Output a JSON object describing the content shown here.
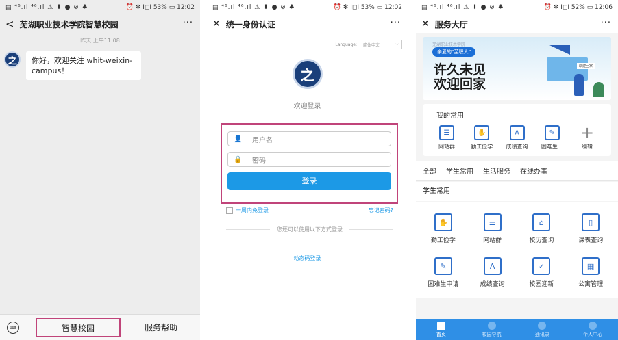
{
  "panel1": {
    "status": {
      "left": "▤ ⁴⁶.ıl ⁴⁶.ıl ⚠ ⬇ ● ⊘ ♣",
      "right": "⏰ ✻ I◻I 53% ▭ 12:02"
    },
    "title": "芜湖职业技术学院智慧校园",
    "more": "···",
    "timestamp": "昨天 上午11:08",
    "avatar": "之",
    "message": "你好，欢迎关注 whit-weixin-campus！",
    "menu": [
      "智慧校园",
      "服务帮助"
    ]
  },
  "panel2": {
    "status": {
      "left": "▤ ⁴⁶.ıl ⁴⁶.ıl ⚠ ⬇ ● ⊘ ♣",
      "right": "⏰ ✻ I◻I 53% ▭ 12:02"
    },
    "title": "统一身份认证",
    "more": "···",
    "language_label": "Language:",
    "language_value": "简体中文",
    "logo": "之",
    "welcome": "欢迎登录",
    "username_placeholder": "用户名",
    "password_placeholder": "密码",
    "login_button": "登录",
    "remember": "一周内免登录",
    "forgot": "忘记密码?",
    "alt_text": "您还可以使用以下方式登录",
    "dynamic_login": "动态码登录"
  },
  "panel3": {
    "status": {
      "left": "▤ ⁴⁶.ıl ⁴⁶.ıl ⚠ ⬇ ● ⊘ ♣",
      "right": "⏰ ✻ I◻I 52% ▭ 12:06"
    },
    "title": "服务大厅",
    "more": "···",
    "banner": {
      "small": "芜湖职业技术学院",
      "pill": "亲爱的“芜职人”",
      "line1": "许久未见",
      "line2": "欢迎回家",
      "sign": "欢迎回家"
    },
    "favorites_title": "我的常用",
    "favorites": [
      "网站群",
      "勤工俭学",
      "成绩查询",
      "困难生...",
      "编辑"
    ],
    "tabs": [
      "全部",
      "学生常用",
      "生活服务",
      "在线办事"
    ],
    "section_title": "学生常用",
    "grid": [
      "勤工俭学",
      "网站群",
      "校历查询",
      "课表查询",
      "困难生申请",
      "成绩查询",
      "校园迎新",
      "公寓管理"
    ],
    "bottom_nav": [
      "首页",
      "校园导航",
      "通讯录",
      "个人中心"
    ]
  }
}
